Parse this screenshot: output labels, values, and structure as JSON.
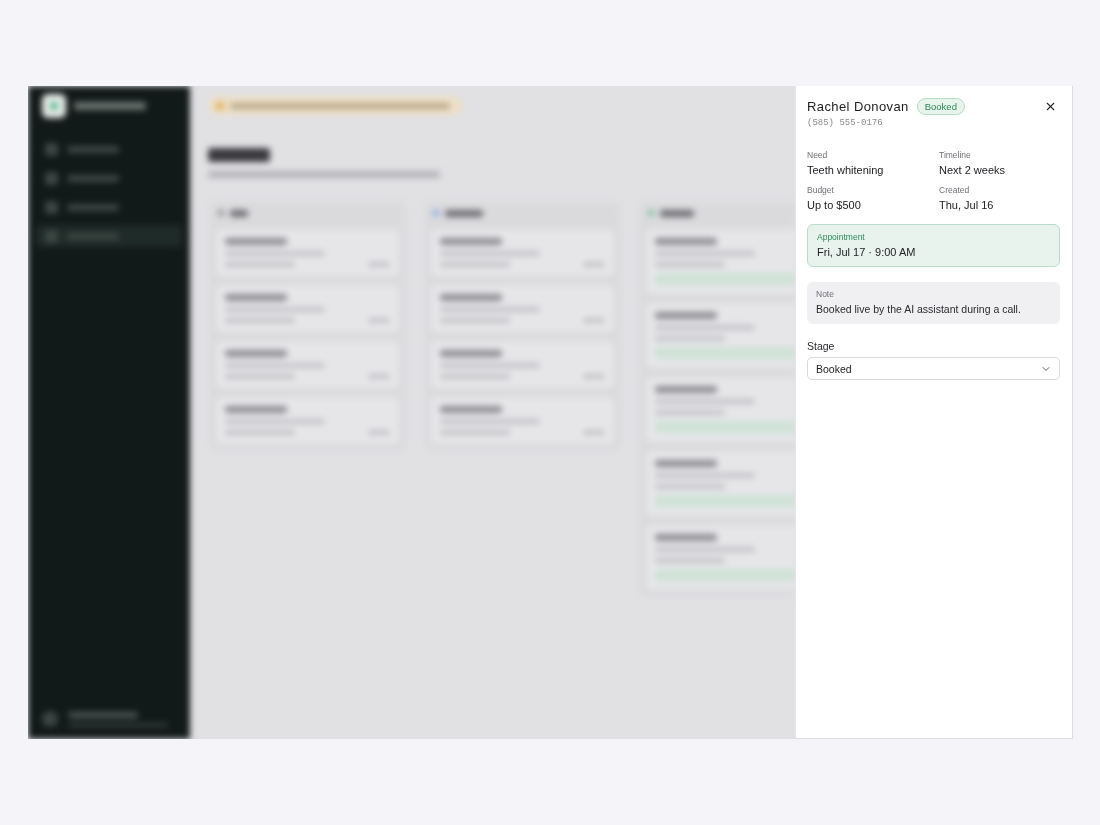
{
  "detail_panel": {
    "name": "Rachel Donovan",
    "status": {
      "label": "Booked",
      "kind": "booked"
    },
    "phone": "(585) 555-0176",
    "fields": [
      {
        "label": "Need",
        "value": "Teeth whitening"
      },
      {
        "label": "Timeline",
        "value": "Next 2 weeks"
      },
      {
        "label": "Budget",
        "value": "Up to $500"
      },
      {
        "label": "Created",
        "value": "Thu, Jul 16"
      }
    ],
    "appointment": {
      "label": "Appointment",
      "value": "Fri, Jul 17 · 9:00 AM"
    },
    "note": {
      "label": "Note",
      "text": "Booked live by the AI assistant during a call."
    },
    "stage": {
      "label": "Stage",
      "value": "Booked"
    }
  }
}
